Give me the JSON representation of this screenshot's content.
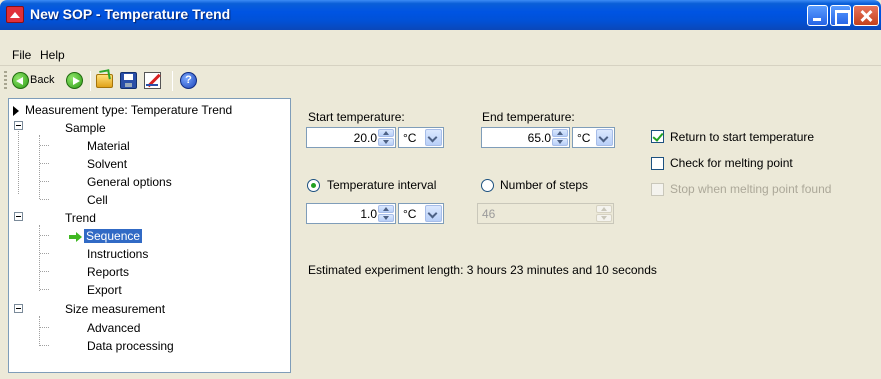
{
  "window": {
    "title": "New SOP - Temperature Trend"
  },
  "menu": {
    "file": "File",
    "help": "Help"
  },
  "toolbar": {
    "back_label": "Back"
  },
  "tree": {
    "root": "Measurement type: Temperature Trend",
    "sample": "Sample",
    "material": "Material",
    "solvent": "Solvent",
    "general_options": "General options",
    "cell": "Cell",
    "trend": "Trend",
    "sequence": "Sequence",
    "instructions": "Instructions",
    "reports": "Reports",
    "export": "Export",
    "size_measurement": "Size measurement",
    "advanced": "Advanced",
    "data_processing": "Data processing"
  },
  "form": {
    "start_temperature": {
      "label": "Start temperature:",
      "value": "20.0",
      "unit": "°C"
    },
    "end_temperature": {
      "label": "End temperature:",
      "value": "65.0",
      "unit": "°C"
    },
    "return_to_start": {
      "label": "Return to start temperature",
      "checked": true
    },
    "check_melting": {
      "label": "Check for melting point",
      "checked": false
    },
    "stop_melting": {
      "label": "Stop when melting point found",
      "checked": false,
      "enabled": false
    },
    "temperature_interval": {
      "label": "Temperature interval",
      "selected": true,
      "value": "1.0",
      "unit": "°C"
    },
    "number_of_steps": {
      "label": "Number of steps",
      "selected": false,
      "value": "46"
    },
    "estimated_length": "Estimated experiment length:  3 hours 23 minutes and 10 seconds"
  }
}
